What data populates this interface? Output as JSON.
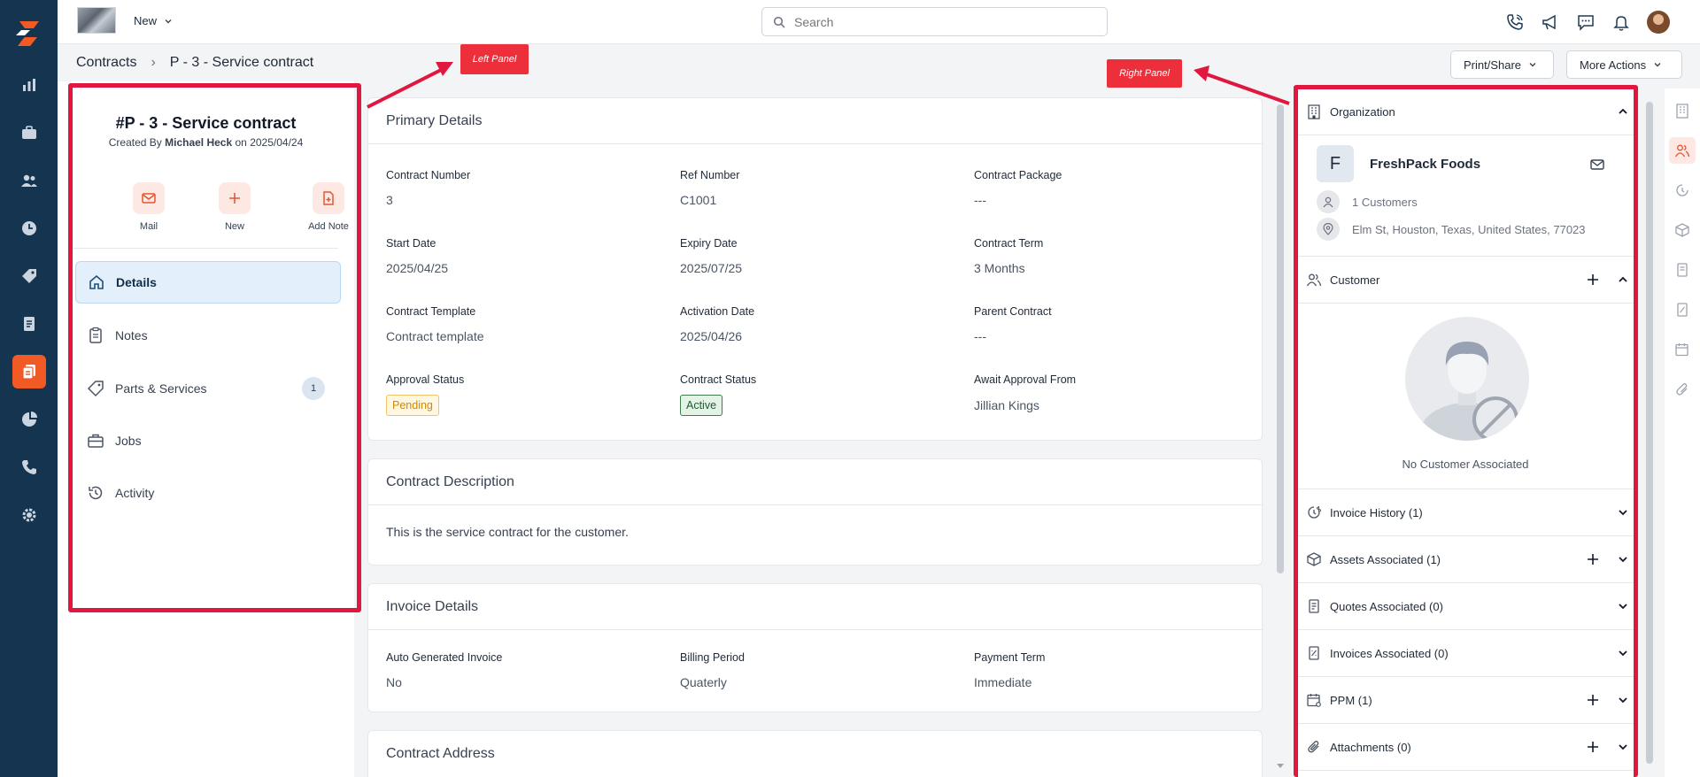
{
  "topbar": {
    "new_label": "New",
    "search_placeholder": "Search"
  },
  "breadcrumb": {
    "root": "Contracts",
    "current": "P - 3 - Service contract"
  },
  "actions": {
    "print_share": "Print/Share",
    "more_actions": "More Actions"
  },
  "left_panel": {
    "title": "#P - 3 - Service contract",
    "created_prefix": "Created By",
    "created_by": "Michael Heck",
    "created_on_prefix": "on",
    "created_on": "2025/04/24",
    "quick_actions": [
      "Mail",
      "New",
      "Add Note"
    ],
    "nav": [
      {
        "label": "Details",
        "icon": "home-icon"
      },
      {
        "label": "Notes",
        "icon": "clipboard-icon"
      },
      {
        "label": "Parts & Services",
        "icon": "tag-icon",
        "badge": "1"
      },
      {
        "label": "Jobs",
        "icon": "briefcase-icon"
      },
      {
        "label": "Activity",
        "icon": "history-icon"
      }
    ]
  },
  "primary_details": {
    "title": "Primary Details",
    "fields": [
      {
        "label": "Contract Number",
        "value": "3"
      },
      {
        "label": "Ref Number",
        "value": "C1001"
      },
      {
        "label": "Contract Package",
        "value": "---"
      },
      {
        "label": "Start Date",
        "value": "2025/04/25"
      },
      {
        "label": "Expiry Date",
        "value": "2025/07/25"
      },
      {
        "label": "Contract Term",
        "value": "3 Months"
      },
      {
        "label": "Contract Template",
        "value": "Contract template"
      },
      {
        "label": "Activation Date",
        "value": "2025/04/26"
      },
      {
        "label": "Parent Contract",
        "value": "---"
      },
      {
        "label": "Approval Status",
        "value": "Pending"
      },
      {
        "label": "Contract Status",
        "value": "Active"
      },
      {
        "label": "Await Approval From",
        "value": "Jillian Kings"
      }
    ]
  },
  "contract_description": {
    "title": "Contract Description",
    "text": "This is the service contract for the customer."
  },
  "invoice_details": {
    "title": "Invoice Details",
    "fields": [
      {
        "label": "Auto Generated Invoice",
        "value": "No"
      },
      {
        "label": "Billing Period",
        "value": "Quaterly"
      },
      {
        "label": "Payment Term",
        "value": "Immediate"
      }
    ]
  },
  "contract_address": {
    "title": "Contract Address"
  },
  "right_panel": {
    "organization": {
      "title": "Organization",
      "initial": "F",
      "name": "FreshPack Foods",
      "customers": "1 Customers",
      "address": "Elm St, Houston, Texas, United States, 77023"
    },
    "customer": {
      "title": "Customer",
      "empty_text": "No Customer Associated"
    },
    "sections": [
      {
        "title": "Invoice History (1)",
        "icon": "dollar-clock-icon",
        "plus": false
      },
      {
        "title": "Assets Associated (1)",
        "icon": "cube-icon",
        "plus": true
      },
      {
        "title": "Quotes Associated (0)",
        "icon": "document-icon",
        "plus": false
      },
      {
        "title": "Invoices Associated (0)",
        "icon": "invoice-icon",
        "plus": false
      },
      {
        "title": "PPM (1)",
        "icon": "calendar-gear-icon",
        "plus": true
      },
      {
        "title": "Attachments (0)",
        "icon": "paperclip-icon",
        "plus": true
      }
    ]
  },
  "annotations": {
    "left_panel": "Left Panel",
    "right_panel": "Right Panel"
  },
  "colors": {
    "rail": "#14344f",
    "accent": "#f15a24",
    "annotation_red": "#e0173f"
  }
}
